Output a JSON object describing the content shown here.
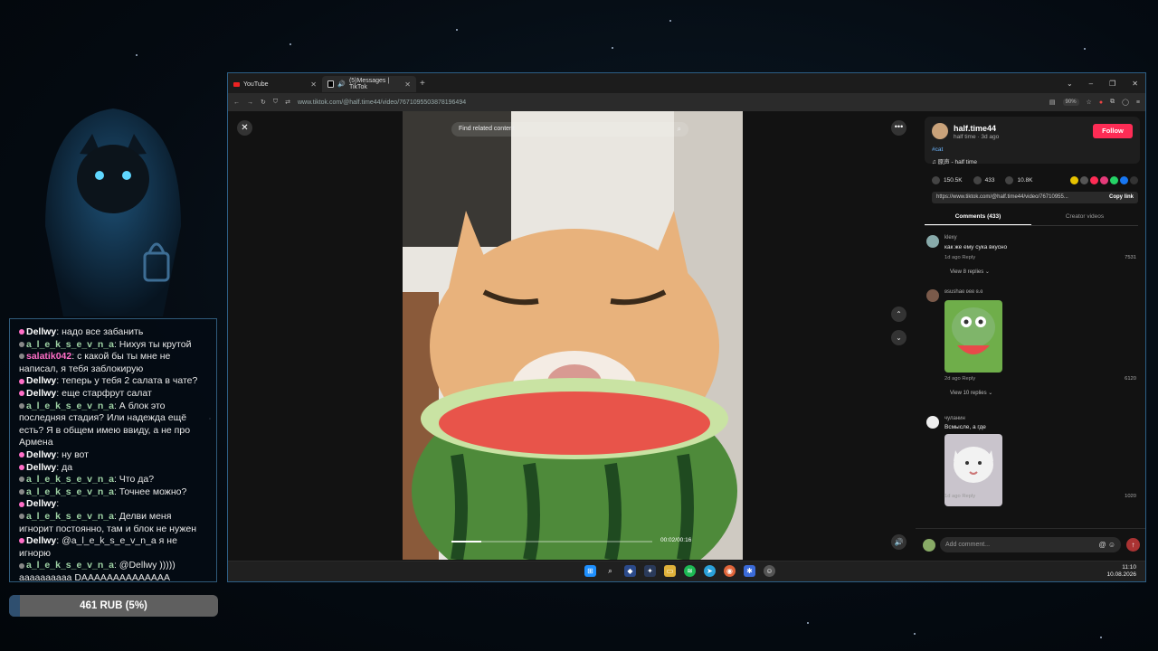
{
  "chat": {
    "messages": [
      {
        "user": "Dellwy",
        "user_color": "#ffffff",
        "text": "надо все забанить"
      },
      {
        "user": "a_l_e_k_s_e_v_n_a",
        "user_color": "#9fd3a5",
        "text": "Нихуя ты крутой"
      },
      {
        "user": "salatik042",
        "user_color": "#ff6ec7",
        "text": "с какой бы ты мне не написал, я тебя заблокирую"
      },
      {
        "user": "Dellwy",
        "user_color": "#ffffff",
        "text": "теперь у тебя 2 салата в чате?"
      },
      {
        "user": "Dellwy",
        "user_color": "#ffffff",
        "text": "еще старфрут салат"
      },
      {
        "user": "a_l_e_k_s_e_v_n_a",
        "user_color": "#9fd3a5",
        "text": "А блок это последняя стадия? Или надежда ещё есть? Я в общем имею ввиду, а не про Армена"
      },
      {
        "user": "Dellwy",
        "user_color": "#ffffff",
        "text": "ну вот"
      },
      {
        "user": "Dellwy",
        "user_color": "#ffffff",
        "text": "да"
      },
      {
        "user": "a_l_e_k_s_e_v_n_a",
        "user_color": "#9fd3a5",
        "text": "Что да?"
      },
      {
        "user": "a_l_e_k_s_e_v_n_a",
        "user_color": "#9fd3a5",
        "text": "Точнее можно?"
      },
      {
        "user": "Dellwy",
        "user_color": "#ffffff",
        "text": ""
      },
      {
        "user": "a_l_e_k_s_e_v_n_a",
        "user_color": "#9fd3a5",
        "text": "Делви меня игнорит постоянно, там и блок не нужен"
      },
      {
        "user": "Dellwy",
        "user_color": "#ffffff",
        "text": "@a_l_e_k_s_e_v_n_a я не игнорю"
      },
      {
        "user": "a_l_e_k_s_e_v_n_a",
        "user_color": "#9fd3a5",
        "text": "@Dellwy ))))) аааааааааа DAAAAAAAAAAAAAA"
      }
    ]
  },
  "donation": {
    "label": "461 RUB (5%)",
    "progress_percent": 5
  },
  "browser": {
    "tabs": [
      {
        "label": "YouTube",
        "active": false
      },
      {
        "label": "(5)Messages | TikTok",
        "active": true
      }
    ],
    "url": "www.tiktok.com/@half.time44/video/7671095503878196494",
    "zoom": "90%"
  },
  "video": {
    "search_placeholder": "Find related content",
    "time": "00:02/00:16",
    "progress_fraction": 0.15
  },
  "post": {
    "author": "half.time44",
    "subtitle": "half time · 3d ago",
    "follow_label": "Follow",
    "hashtag": "#cat",
    "sound": "♫ 原声 - half time",
    "likes": "150.5K",
    "comments": "433",
    "saves": "10.8K",
    "link": "https://www.tiktok.com/@half.time44/video/76710955...",
    "copy_label": "Copy link",
    "tab_comments": "Comments (433)",
    "tab_creator": "Creator videos"
  },
  "comments": [
    {
      "user": "klexy",
      "text": "как же ему сука вкусно",
      "meta": "1d ago   Reply",
      "likes": "7531",
      "replies": "View 8 replies ⌄"
    },
    {
      "user": "ʚsushaɞ ʚɞɞ ɞ.ɞ",
      "text": "",
      "meta": "2d ago   Reply",
      "likes": "6120",
      "replies": "View 10 replies ⌄"
    },
    {
      "user": "чуланин",
      "text": "Всмысле, а где",
      "meta": "1d ago   Reply",
      "likes": "1020",
      "replies": ""
    }
  ],
  "comment_input": {
    "placeholder": "Add comment..."
  },
  "clock": {
    "time": "11:10",
    "date": "10.08.2026"
  }
}
